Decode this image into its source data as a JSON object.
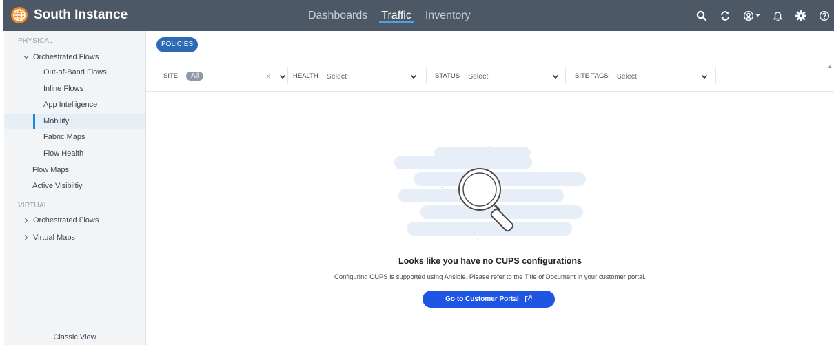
{
  "app": {
    "title": "South Instance"
  },
  "nav": {
    "tabs": [
      {
        "label": "Dashboards"
      },
      {
        "label": "Traffic"
      },
      {
        "label": "Inventory"
      }
    ],
    "active": "Traffic"
  },
  "toolbar_icons": [
    "search-icon",
    "refresh-icon",
    "user-icon",
    "bell-icon",
    "gear-icon",
    "help-icon"
  ],
  "sidebar": {
    "physical_label": "PHYSICAL",
    "orchestrated_flows": "Orchestrated Flows",
    "sub_items": [
      "Out-of-Band Flows",
      "Inline Flows",
      "App Intelligence",
      "Mobility",
      "Fabric Maps",
      "Flow Health"
    ],
    "active_item": "Mobility",
    "flow_maps": "Flow Maps",
    "active_visibility": "Active Visibiltiy",
    "virtual_label": "VIRTUAL",
    "virtual_items": [
      "Orchestrated Flows",
      "Virtual Maps"
    ],
    "classic_view": "Classic View"
  },
  "main": {
    "policies_button": "POLICIES",
    "filters": {
      "site": {
        "label": "SITE",
        "chip": "All"
      },
      "health": {
        "label": "HEALTH",
        "placeholder": "Select"
      },
      "status": {
        "label": "STATUS",
        "placeholder": "Select"
      },
      "site_tags": {
        "label": "SITE TAGS",
        "placeholder": "Select"
      }
    },
    "empty_title": "Looks like you have no CUPS configurations",
    "empty_description": "Configuring CUPS is supported using Ansible. Please refer to the Title of Document in your customer portal.",
    "portal_button": "Go to Customer Portal"
  },
  "colors": {
    "topbar": "#4d5866",
    "accent": "#1e55e3",
    "policies": "#2b6bb4",
    "active_marker": "#1e88e5"
  }
}
